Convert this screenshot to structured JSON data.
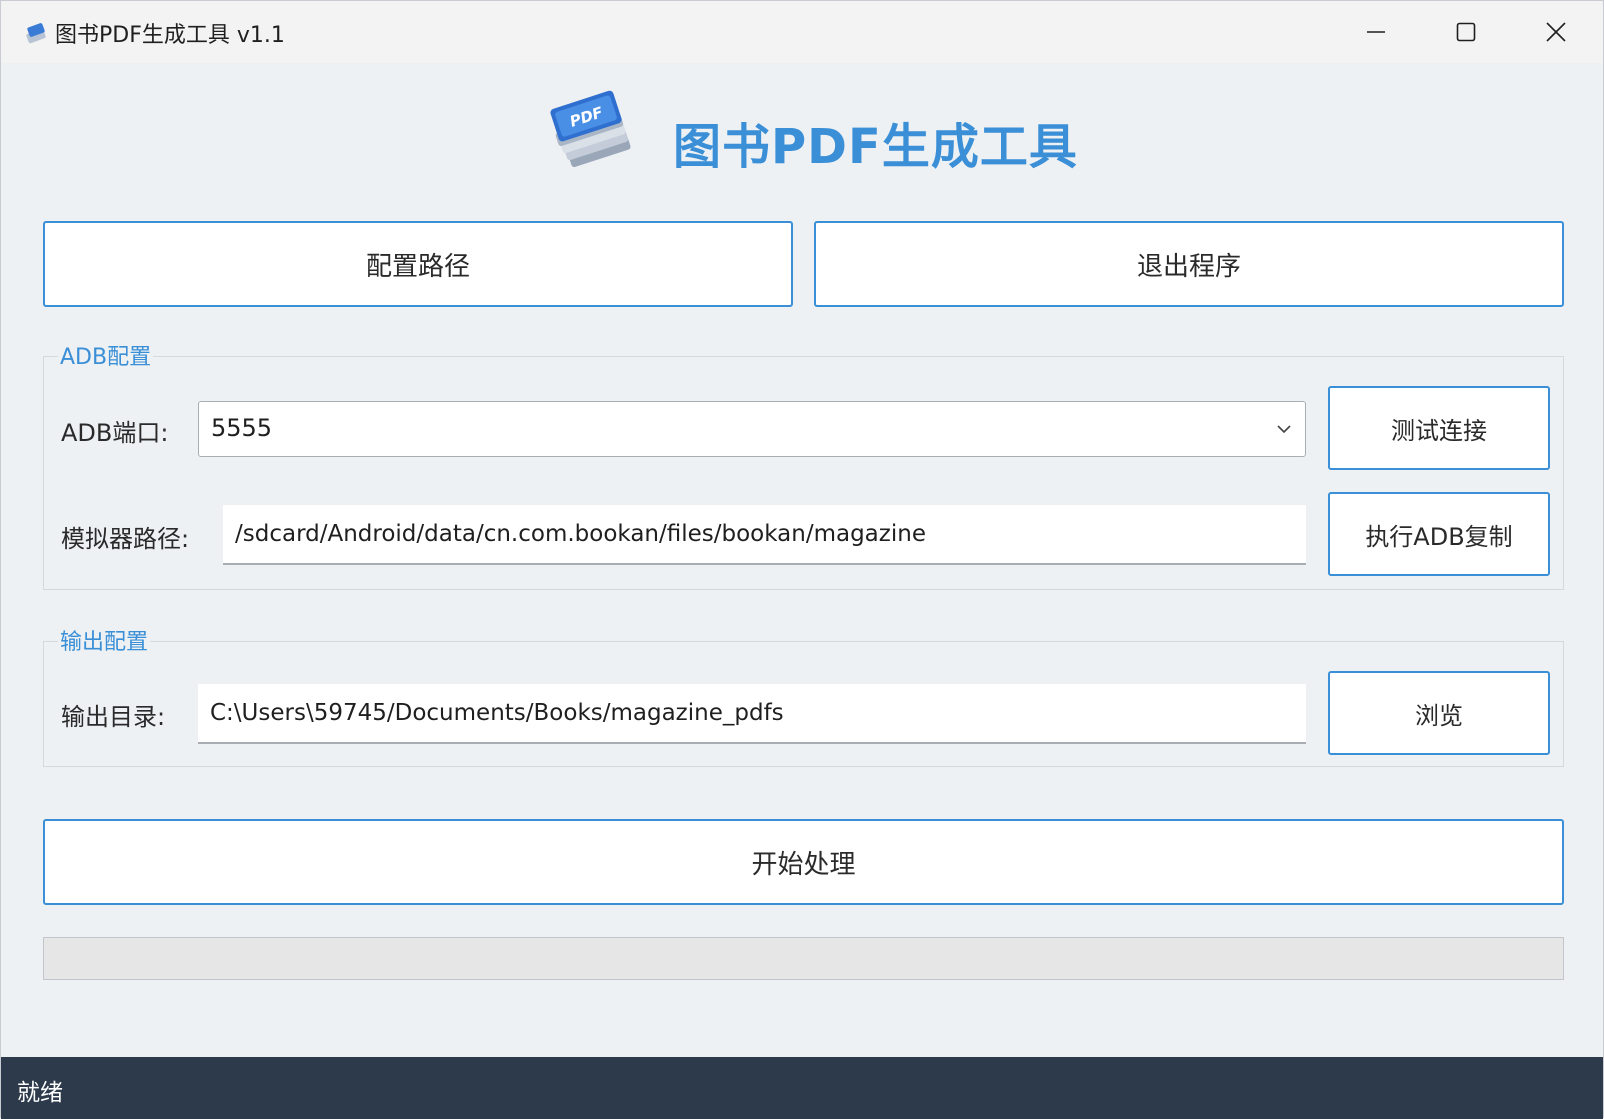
{
  "window": {
    "title": "图书PDF生成工具 v1.1"
  },
  "header": {
    "title": "图书PDF生成工具",
    "logo_icon": "pdf-stack-icon",
    "logo_label": "PDF"
  },
  "top_buttons": {
    "config_label": "配置路径",
    "exit_label": "退出程序"
  },
  "adb_group": {
    "legend": "ADB配置",
    "port_label": "ADB端口:",
    "port_value": "5555",
    "test_button": "测试连接",
    "emulator_path_label": "模拟器路径:",
    "emulator_path_value": "/sdcard/Android/data/cn.com.bookan/files/bookan/magazine",
    "copy_button": "执行ADB复制"
  },
  "output_group": {
    "legend": "输出配置",
    "dir_label": "输出目录:",
    "dir_value": "C:\\Users\\59745/Documents/Books/magazine_pdfs",
    "browse_button": "浏览"
  },
  "start_button": "开始处理",
  "progress": {
    "value": 0
  },
  "status": {
    "text": "就绪"
  },
  "colors": {
    "accent": "#3a8fd6",
    "background": "#eef1f4",
    "statusbar": "#2d3a4b"
  }
}
